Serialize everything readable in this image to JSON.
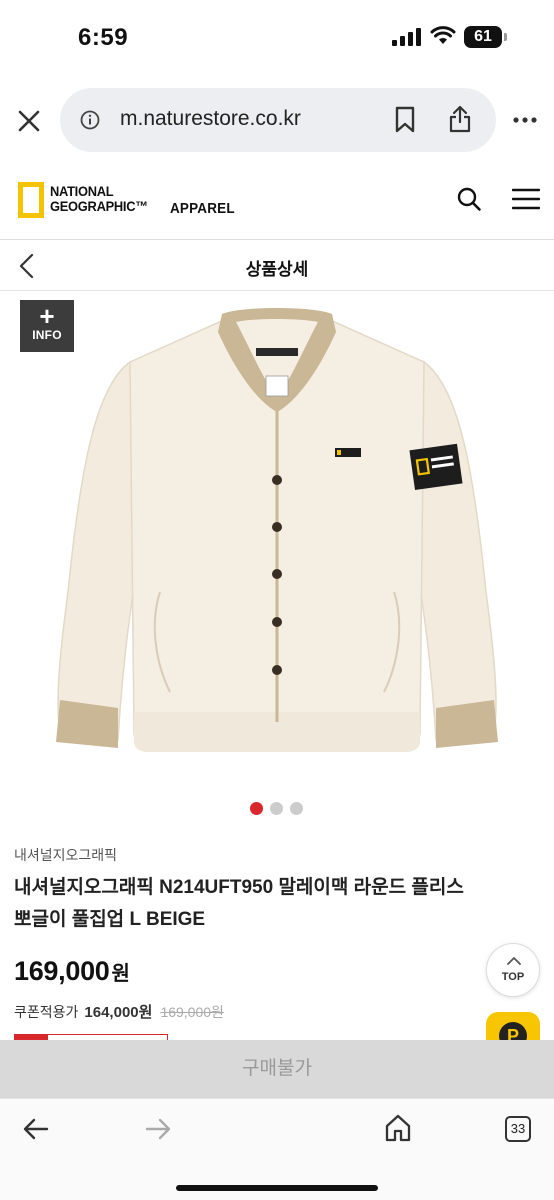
{
  "status_bar": {
    "time": "6:59",
    "battery": "61"
  },
  "browser": {
    "url": "m.naturestore.co.kr",
    "tab_count": "33"
  },
  "header": {
    "brand_line1": "NATIONAL",
    "brand_line2": "GEOGRAPHIC™",
    "brand_sub": "APPAREL"
  },
  "page_nav": {
    "title": "상품상세"
  },
  "image": {
    "info_badge_plus": "+",
    "info_badge_label": "INFO",
    "patch_text1": "NATIONAL",
    "patch_text2": "GEOGRAPHIC",
    "carousel_total": 3,
    "carousel_active": 1
  },
  "product": {
    "brand": "내셔널지오그래픽",
    "title_line1": "내셔널지오그래픽 N214UFT950 말레이맥 라운드 플리스",
    "title_line2": "뽀글이 풀집업 L BEIGE",
    "price": "169,000",
    "price_unit": "원",
    "coupon_label": "쿠폰적용가",
    "coupon_price": "164,000원",
    "original_price": "169,000원"
  },
  "floating": {
    "top_label": "TOP",
    "point_label": "P"
  },
  "buy_button": {
    "label": "구매불가"
  },
  "colors": {
    "logo_yellow": "#f5c400",
    "dot_active": "#d8282b",
    "dot_inactive": "#cccccc",
    "disabled_button": "#d9d9d9"
  }
}
